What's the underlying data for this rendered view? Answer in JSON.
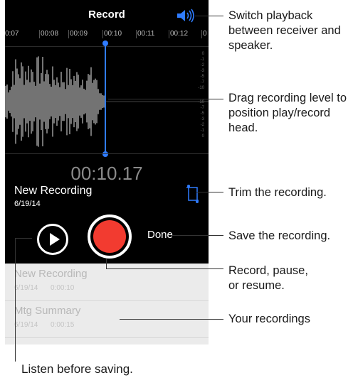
{
  "app": {
    "title": "Record"
  },
  "timeline": {
    "ticks": [
      "0:07",
      "00:08",
      "00:09",
      "00:10",
      "00:11",
      "00:12",
      "0"
    ]
  },
  "db_scale": [
    "0",
    "-1",
    "-2",
    "-3",
    "-5",
    "-7",
    "-10",
    "-10",
    "-7",
    "-5",
    "-3",
    "-2",
    "-1",
    "0"
  ],
  "recording": {
    "timer": "00:10.17",
    "name": "New Recording",
    "date": "6/19/14"
  },
  "controls": {
    "done_label": "Done"
  },
  "recordings_list": [
    {
      "name": "New Recording",
      "date": "6/19/14",
      "duration": "0:00:10"
    },
    {
      "name": "Mtg Summary",
      "date": "6/19/14",
      "duration": "0:00:15"
    }
  ],
  "callouts": {
    "speaker": "Switch playback between receiver and speaker.",
    "playhead": "Drag recording level to position play/record head.",
    "trim": "Trim the recording.",
    "save": "Save the recording.",
    "record": "Record, pause, or resume.",
    "recordings": "Your recordings",
    "listen": "Listen before saving."
  },
  "colors": {
    "accent_blue": "#2f7cff",
    "record_red": "#f23b30",
    "background_dark": "#000000",
    "list_background": "#ebebeb"
  }
}
